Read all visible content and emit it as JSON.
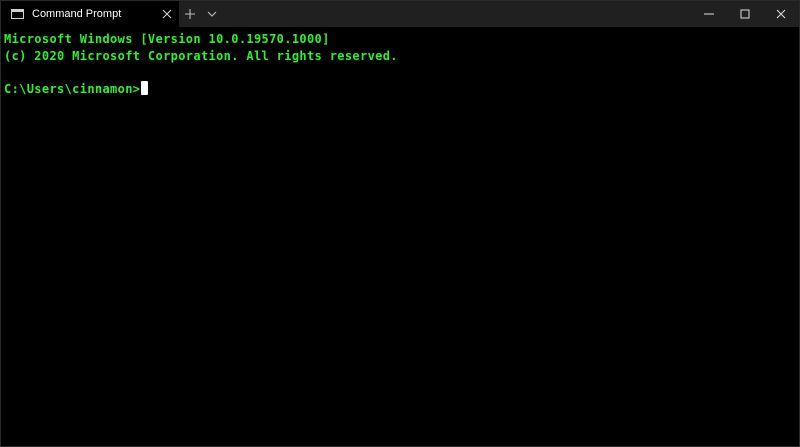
{
  "window": {
    "tab": {
      "title": "Command Prompt",
      "icon": "terminal-icon",
      "close_icon": "close-icon"
    },
    "new_tab_icon": "plus-icon",
    "dropdown_icon": "chevron-down-icon",
    "controls": {
      "minimize_icon": "minimize-icon",
      "maximize_icon": "maximize-icon",
      "close_icon": "close-icon"
    }
  },
  "terminal": {
    "text_color": "#2bf22b",
    "background": "#000000",
    "lines": [
      "Microsoft Windows [Version 10.0.19570.1000]",
      "(c) 2020 Microsoft Corporation. All rights reserved.",
      "",
      "C:\\Users\\cinnamon>"
    ]
  }
}
